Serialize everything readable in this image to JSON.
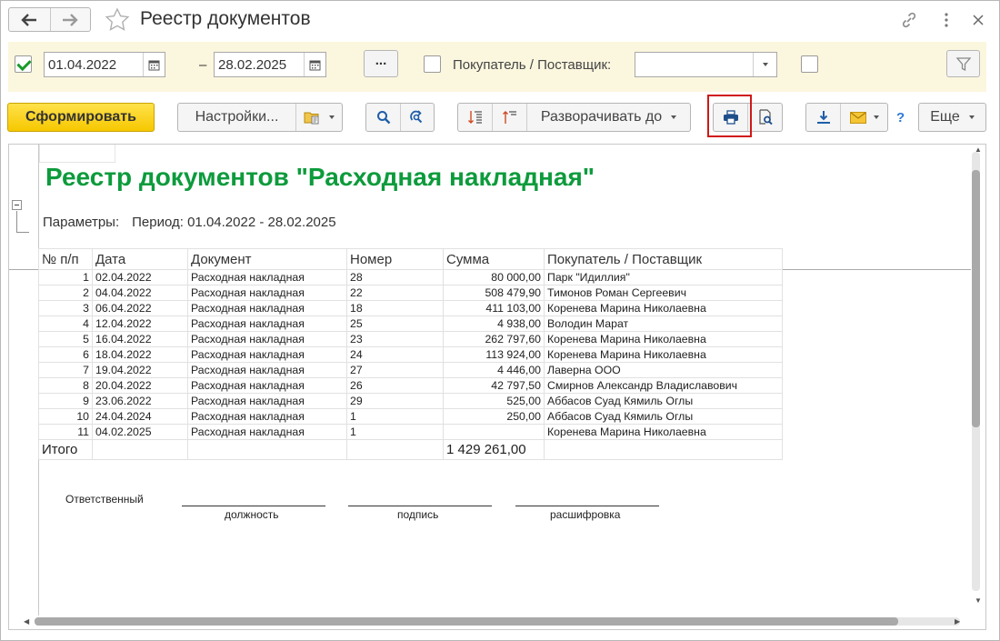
{
  "window": {
    "title": "Реестр документов"
  },
  "filters": {
    "date_from": "01.04.2022",
    "date_to": "28.02.2025",
    "dash": "–",
    "ellipsis_label": "...",
    "counterparty_label": "Покупатель / Поставщик:",
    "counterparty_value": ""
  },
  "toolbar": {
    "generate_label": "Сформировать",
    "settings_label": "Настройки...",
    "expand_label": "Разворачивать до",
    "help_label": "?",
    "more_label": "Еще"
  },
  "report": {
    "title": "Реестр документов \"Расходная накладная\"",
    "params_label": "Параметры:",
    "params_value": "Период: 01.04.2022 - 28.02.2025",
    "columns": [
      "№ п/п",
      "Дата",
      "Документ",
      "Номер",
      "Сумма",
      "Покупатель / Поставщик"
    ],
    "rows": [
      [
        "1",
        "02.04.2022",
        "Расходная накладная",
        "28",
        "80 000,00",
        "Парк \"Идиллия\""
      ],
      [
        "2",
        "04.04.2022",
        "Расходная накладная",
        "22",
        "508 479,90",
        "Тимонов Роман Сергеевич"
      ],
      [
        "3",
        "06.04.2022",
        "Расходная накладная",
        "18",
        "411 103,00",
        "Коренева Марина Николаевна"
      ],
      [
        "4",
        "12.04.2022",
        "Расходная накладная",
        "25",
        "4 938,00",
        "Володин Марат"
      ],
      [
        "5",
        "16.04.2022",
        "Расходная накладная",
        "23",
        "262 797,60",
        "Коренева Марина Николаевна"
      ],
      [
        "6",
        "18.04.2022",
        "Расходная накладная",
        "24",
        "113 924,00",
        "Коренева Марина Николаевна"
      ],
      [
        "7",
        "19.04.2022",
        "Расходная накладная",
        "27",
        "4 446,00",
        "Лаверна ООО"
      ],
      [
        "8",
        "20.04.2022",
        "Расходная накладная",
        "26",
        "42 797,50",
        "Смирнов Александр Владиславович"
      ],
      [
        "9",
        "23.06.2022",
        "Расходная накладная",
        "29",
        "525,00",
        "Аббасов Суад Кямиль Оглы"
      ],
      [
        "10",
        "24.04.2024",
        "Расходная накладная",
        "1",
        "250,00",
        "Аббасов Суад Кямиль Оглы"
      ],
      [
        "11",
        "04.02.2025",
        "Расходная накладная",
        "1",
        "",
        "Коренева Марина Николаевна"
      ]
    ],
    "total_label": "Итого",
    "total_value": "1 429 261,00",
    "signature": {
      "responsible": "Ответственный",
      "position": "должность",
      "signature": "подпись",
      "decoding": "расшифровка"
    }
  },
  "colors": {
    "title_green": "#0d9b3c",
    "primary_yellow": "#f6c800",
    "filter_bg": "#fbf6de",
    "highlight_red": "#d01818"
  }
}
